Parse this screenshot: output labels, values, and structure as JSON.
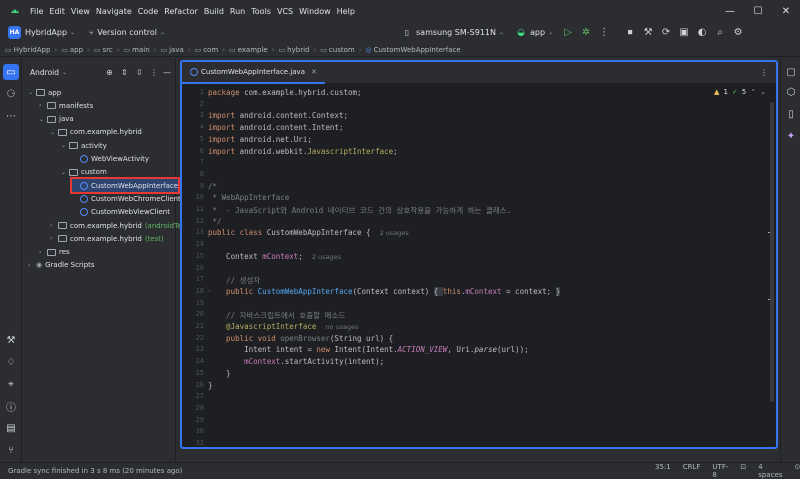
{
  "menu": [
    "File",
    "Edit",
    "View",
    "Navigate",
    "Code",
    "Refactor",
    "Build",
    "Run",
    "Tools",
    "VCS",
    "Window",
    "Help"
  ],
  "toolbar": {
    "project_badge": "HA",
    "project_name": "HybridApp",
    "version_control": "Version control",
    "device": "samsung SM-S911N",
    "run_config": "app"
  },
  "breadcrumb": [
    "HybridApp",
    "app",
    "src",
    "main",
    "java",
    "com",
    "example",
    "hybrid",
    "custom",
    "CustomWebAppInterface"
  ],
  "project_panel": {
    "view_mode": "Android",
    "tree": [
      {
        "label": "app",
        "indent": 0,
        "kind": "folder",
        "expanded": true
      },
      {
        "label": "manifests",
        "indent": 1,
        "kind": "folder",
        "expanded": false
      },
      {
        "label": "java",
        "indent": 1,
        "kind": "folder",
        "expanded": true
      },
      {
        "label": "com.example.hybrid",
        "indent": 2,
        "kind": "folder",
        "expanded": true
      },
      {
        "label": "activity",
        "indent": 3,
        "kind": "folder",
        "expanded": true
      },
      {
        "label": "WebViewActivity",
        "indent": 4,
        "kind": "class"
      },
      {
        "label": "custom",
        "indent": 3,
        "kind": "folder",
        "expanded": true
      },
      {
        "label": "CustomWebAppInterface",
        "indent": 4,
        "kind": "class",
        "selected": true
      },
      {
        "label": "CustomWebChromeClient",
        "indent": 4,
        "kind": "class"
      },
      {
        "label": "CustomWebViewClient",
        "indent": 4,
        "kind": "class"
      },
      {
        "label": "com.example.hybrid",
        "suffix": "(androidTest)",
        "indent": 2,
        "kind": "folder",
        "expanded": false
      },
      {
        "label": "com.example.hybrid",
        "suffix": "(test)",
        "indent": 2,
        "kind": "folder",
        "expanded": false
      },
      {
        "label": "res",
        "indent": 1,
        "kind": "folder",
        "expanded": false
      },
      {
        "label": "Gradle Scripts",
        "indent": 0,
        "kind": "gradle",
        "expanded": false
      }
    ]
  },
  "editor": {
    "tab_label": "CustomWebAppInterface.java",
    "inspection": {
      "warnings": "1",
      "weak": "5"
    },
    "line_numbers": [
      "1",
      "2",
      "3",
      "4",
      "5",
      "6",
      "7",
      "8",
      "9",
      "10",
      "11",
      "12",
      "13",
      "14",
      "15",
      "16",
      "17",
      "18",
      "19",
      "20",
      "21",
      "22",
      "23",
      "24",
      "25",
      "26",
      "27",
      "28",
      "29",
      "30",
      "31"
    ],
    "code_lines": [
      [
        {
          "t": "package ",
          "c": "kw"
        },
        {
          "t": "com.example.hybrid.custom;",
          "c": ""
        }
      ],
      [],
      [
        {
          "t": "import ",
          "c": "kw"
        },
        {
          "t": "android.content.Context;",
          "c": ""
        }
      ],
      [
        {
          "t": "import ",
          "c": "kw"
        },
        {
          "t": "android.content.Intent;",
          "c": ""
        }
      ],
      [
        {
          "t": "import ",
          "c": "kw"
        },
        {
          "t": "android.net.Uri;",
          "c": ""
        }
      ],
      [
        {
          "t": "import ",
          "c": "kw"
        },
        {
          "t": "android.webkit.",
          "c": ""
        },
        {
          "t": "JavascriptInterface",
          "c": "an"
        },
        {
          "t": ";",
          "c": ""
        }
      ],
      [],
      [],
      [
        {
          "t": "/*",
          "c": "cm"
        }
      ],
      [
        {
          "t": " * WebAppInterface",
          "c": "cm"
        }
      ],
      [
        {
          "t": " *  - JavaScript와 Android 네이티브 코드 간의 상호작용을 가능하게 하는 클래스.",
          "c": "cm"
        }
      ],
      [
        {
          "t": " */",
          "c": "cm"
        }
      ],
      [
        {
          "t": "public class ",
          "c": "kw"
        },
        {
          "t": "CustomWebAppInterface {  ",
          "c": ""
        },
        {
          "t": "2 usages",
          "c": "hint"
        }
      ],
      [],
      [
        {
          "t": "    Context ",
          "c": ""
        },
        {
          "t": "mContext",
          "c": "fld"
        },
        {
          "t": ";  ",
          "c": ""
        },
        {
          "t": "2 usages",
          "c": "hint"
        }
      ],
      [],
      [
        {
          "t": "    // 생성자",
          "c": "cm"
        }
      ],
      [
        {
          "t": "    public ",
          "c": "kw"
        },
        {
          "t": "CustomWebAppInterface",
          "c": "fn"
        },
        {
          "t": "(Context context) ",
          "c": ""
        },
        {
          "t": "{ ",
          "c": "hl"
        },
        {
          "t": "this",
          "c": "kw"
        },
        {
          "t": ".",
          "c": ""
        },
        {
          "t": "mContext",
          "c": "fld"
        },
        {
          "t": " = context; ",
          "c": ""
        },
        {
          "t": "}",
          "c": "hl"
        }
      ],
      [],
      [
        {
          "t": "    // 자바스크립트에서 호출할 메소드",
          "c": "cm"
        }
      ],
      [
        {
          "t": "    @JavascriptInterface  ",
          "c": "an"
        },
        {
          "t": "no usages",
          "c": "hint"
        }
      ],
      [
        {
          "t": "    public void ",
          "c": "kw"
        },
        {
          "t": "openBrowser",
          "c": "cm"
        },
        {
          "t": "(String url) {",
          "c": ""
        }
      ],
      [
        {
          "t": "        Intent intent = ",
          "c": ""
        },
        {
          "t": "new ",
          "c": "kw"
        },
        {
          "t": "Intent(Intent.",
          "c": ""
        },
        {
          "t": "ACTION_VIEW",
          "c": "fld it"
        },
        {
          "t": ", Uri.",
          "c": ""
        },
        {
          "t": "parse",
          "c": "it"
        },
        {
          "t": "(url));",
          "c": ""
        }
      ],
      [
        {
          "t": "        ",
          "c": ""
        },
        {
          "t": "mContext",
          "c": "fld"
        },
        {
          "t": ".startActivity(intent);",
          "c": ""
        }
      ],
      [
        {
          "t": "    }",
          "c": ""
        }
      ],
      [
        {
          "t": "}",
          "c": ""
        }
      ],
      [],
      [],
      [],
      [],
      []
    ]
  },
  "status": {
    "message": "Gradle sync finished in 3 s 8 ms (20 minutes ago)",
    "position": "35:1",
    "line_sep": "CRLF",
    "encoding": "UTF-8",
    "indent": "4 spaces"
  },
  "colors": {
    "accent": "#3574f0",
    "selection_outline": "#e53935",
    "run": "#5fb865"
  }
}
